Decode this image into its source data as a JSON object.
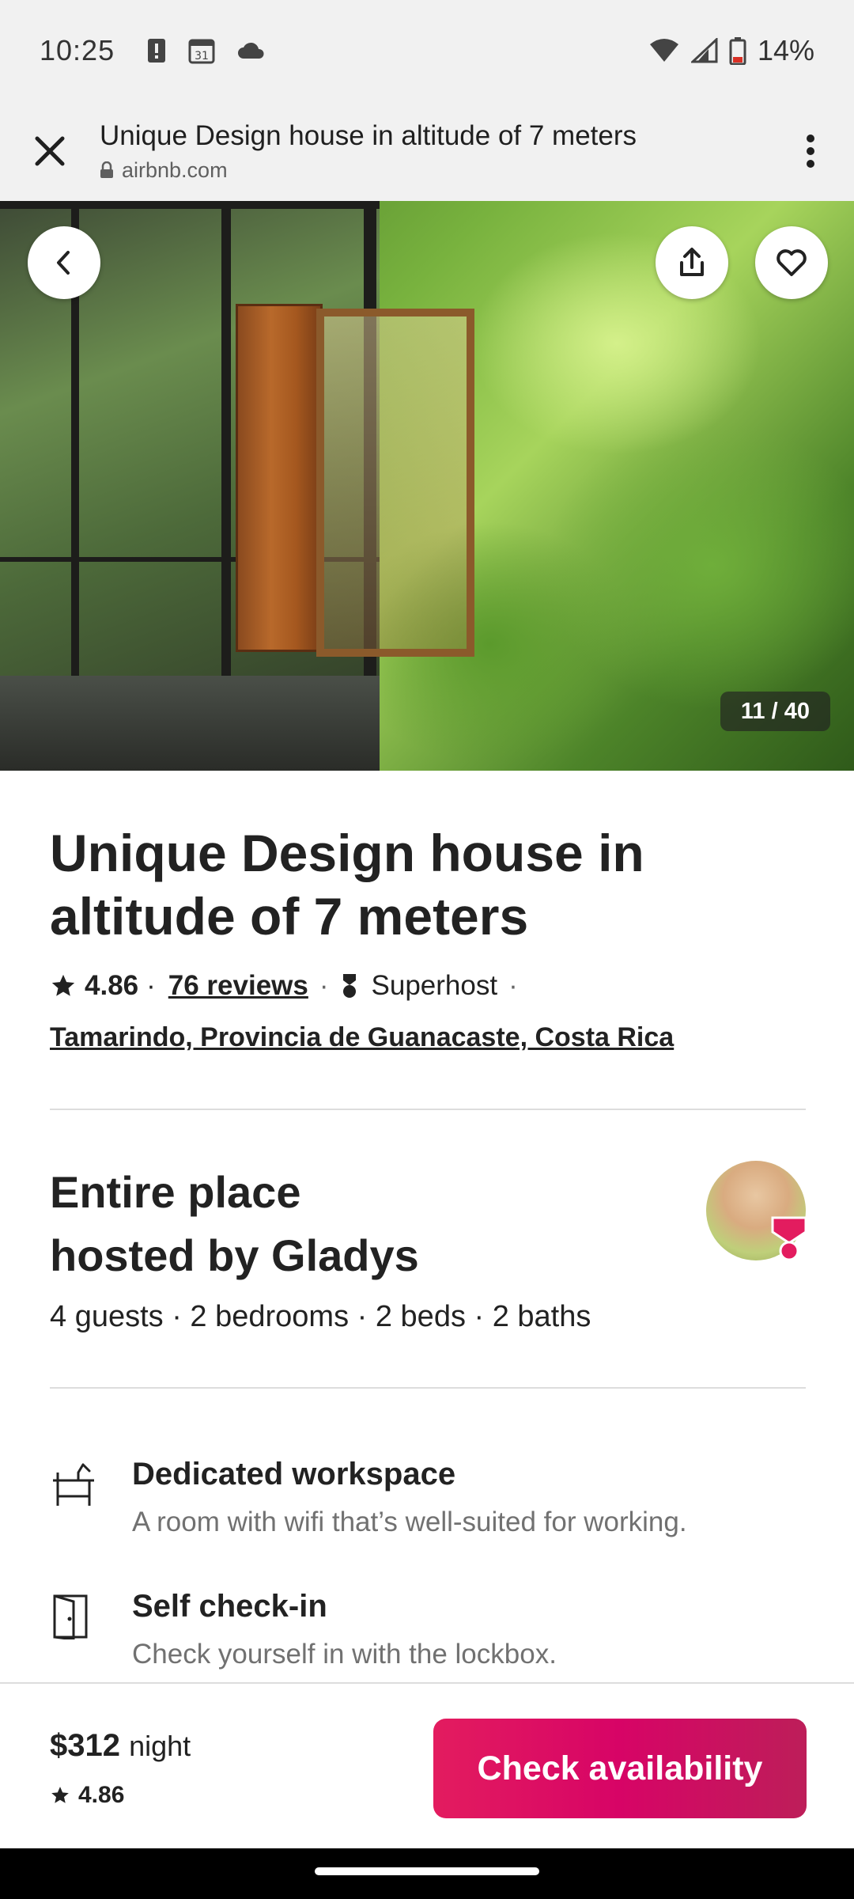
{
  "status_bar": {
    "time": "10:25",
    "battery_percent": "14%",
    "icons": [
      "alert-icon",
      "calendar-icon",
      "cloud-icon",
      "wifi-icon",
      "signal-icon",
      "battery-icon"
    ]
  },
  "browser": {
    "page_title": "Unique Design house in altitude of 7 meters",
    "url": "airbnb.com"
  },
  "gallery": {
    "counter": "11 / 40",
    "current": 11,
    "total": 40
  },
  "listing": {
    "title": "Unique Design house in altitude of 7 meters",
    "rating": "4.86",
    "rating_sep": "·",
    "reviews_link": "76 reviews",
    "separator": "·",
    "superhost_label": "Superhost",
    "location": "Tamarindo, Provincia de Guanacaste, Costa Rica"
  },
  "host": {
    "title_line1": "Entire place",
    "title_line2": "hosted by Gladys",
    "details": "4 guests · 2 bedrooms · 2 beds · 2 baths"
  },
  "features": [
    {
      "icon": "desk-icon",
      "title": "Dedicated workspace",
      "description": "A room with wifi that’s well-suited for working."
    },
    {
      "icon": "door-icon",
      "title": "Self check-in",
      "description": "Check yourself in with the lockbox."
    }
  ],
  "booking": {
    "price": "$312",
    "price_unit": "night",
    "rating": "4.86",
    "cta_label": "Check availability"
  },
  "colors": {
    "brand": "#e31c5f",
    "text": "#222222",
    "muted": "#717171",
    "divider": "#dddddd"
  }
}
